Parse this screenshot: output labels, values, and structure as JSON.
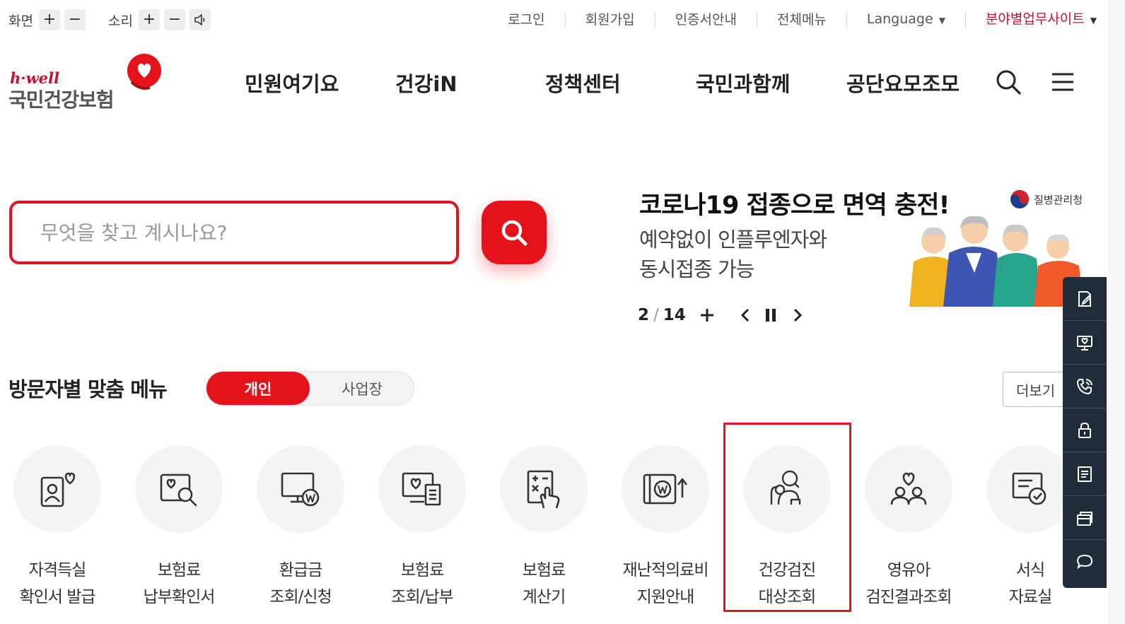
{
  "utility": {
    "screen_label": "화면",
    "sound_label": "소리",
    "plus": "+",
    "minus": "−",
    "links": [
      "로그인",
      "회원가입",
      "인증서안내",
      "전체메뉴"
    ],
    "language_label": "Language",
    "sites_label": "분야별업무사이트"
  },
  "logo": {
    "hwell": "h·well",
    "name": "국민건강보험"
  },
  "gnb": [
    "민원여기요",
    "건강iN",
    "정책센터",
    "국민과함께",
    "공단요모조모"
  ],
  "search": {
    "placeholder": "무엇을 찾고 계시나요?",
    "value": ""
  },
  "banner": {
    "title": "코로나19 접종으로 면역 충전!",
    "subtitle": "예약없이 인플루엔자와\n동시접종 가능",
    "agency": "질병관리청",
    "current": "2",
    "separator": "/",
    "total": "14"
  },
  "visitor_menu": {
    "title": "방문자별 맞춤 메뉴",
    "tab_personal": "개인",
    "tab_business": "사업장",
    "more_label": "더보기"
  },
  "quick_menu": [
    {
      "line1": "자격득실",
      "line2": "확인서 발급",
      "icon": "id-heart-icon"
    },
    {
      "line1": "보험료",
      "line2": "납부확인서",
      "icon": "document-search-icon"
    },
    {
      "line1": "환급금",
      "line2": "조회/신청",
      "icon": "monitor-won-icon"
    },
    {
      "line1": "보험료",
      "line2": "조회/납부",
      "icon": "monitor-receipt-icon"
    },
    {
      "line1": "보험료",
      "line2": "계산기",
      "icon": "calculator-hand-icon"
    },
    {
      "line1": "재난적의료비",
      "line2": "지원안내",
      "icon": "money-support-icon"
    },
    {
      "line1": "건강검진",
      "line2": "대상조회",
      "icon": "person-search-icon"
    },
    {
      "line1": "영유아",
      "line2": "검진결과조회",
      "icon": "family-heart-icon"
    },
    {
      "line1": "서식",
      "line2": "자료실",
      "icon": "form-check-icon"
    }
  ],
  "highlighted_item": "건강검진 대상조회",
  "quick_bar_icons": [
    "edit-document-icon",
    "monitor-icon",
    "phone-icon",
    "lock-icon",
    "list-icon",
    "cards-icon",
    "chat-icon"
  ],
  "colors": {
    "brand_red": "#e4131b",
    "quickbar_bg": "#1f2d3a",
    "highlight_border": "#e0141e"
  }
}
